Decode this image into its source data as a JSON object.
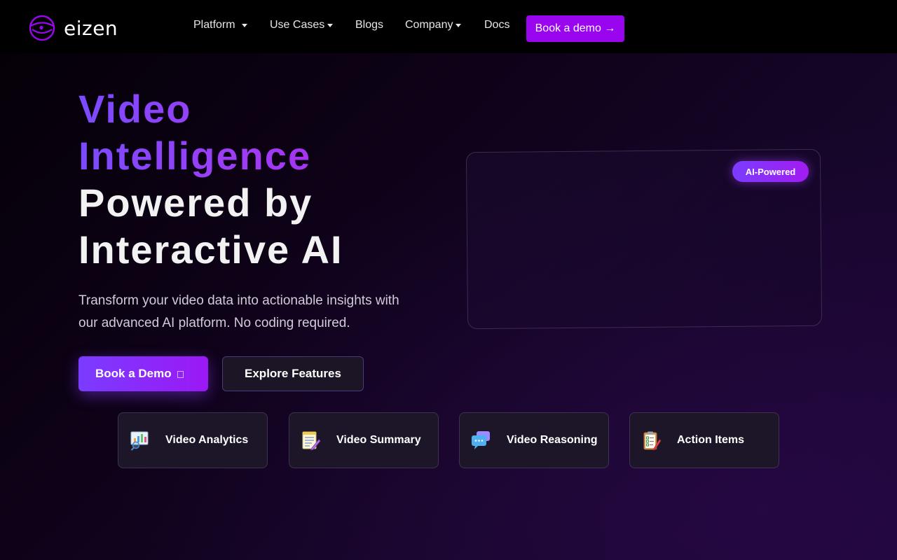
{
  "brand": {
    "name": "eizen"
  },
  "nav": {
    "items": [
      {
        "label": "Platform",
        "dropdown": true
      },
      {
        "label": "Use Cases",
        "dropdown": true
      },
      {
        "label": "Blogs",
        "dropdown": false
      },
      {
        "label": "Company",
        "dropdown": true
      },
      {
        "label": "Docs",
        "dropdown": false
      }
    ],
    "cta_label": "Book a demo →"
  },
  "hero": {
    "headline": {
      "line1": "Video",
      "line2": "Intelligence",
      "line3": "Powered by",
      "line4": "Interactive AI"
    },
    "subtitle": "Transform your video data into actionable insights with our advanced AI platform. No coding required.",
    "primary_button": "Book a Demo",
    "secondary_button": "Explore Features",
    "badge": "AI-Powered"
  },
  "features": [
    {
      "label": "Video Analytics",
      "icon": "analytics-icon"
    },
    {
      "label": "Video Summary",
      "icon": "notepad-icon"
    },
    {
      "label": "Video Reasoning",
      "icon": "chat-bubbles-icon"
    },
    {
      "label": "Action Items",
      "icon": "clipboard-checklist-icon"
    }
  ],
  "colors": {
    "accent": "#9a05f0",
    "gradient_start": "#7b4bff",
    "gradient_end": "#a930f0",
    "background": "#0e0218"
  }
}
